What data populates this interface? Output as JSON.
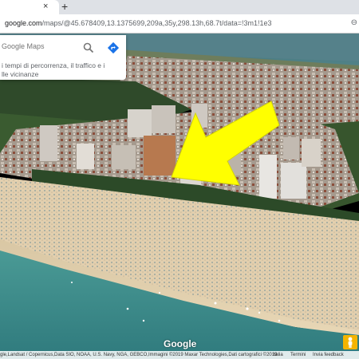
{
  "browser": {
    "url_host": "google.com",
    "url_path": "/maps/@45.678409,13.1375699,209a,35y,298.13h,68.7t/data=!3m1!1e3",
    "new_tab_symbol": "+",
    "close_symbol": "×"
  },
  "search": {
    "placeholder": "Google Maps",
    "hint": "i tempi di percorrenza, il traffico e i\nlle vicinanze"
  },
  "map": {
    "logo": "Google",
    "attribution": "gle,Landsat / Copernicus,Data SIO, NOAA, U.S. Navy, NGA, GEBCO,Immagini ©2019 Maxar Technologies,Dati cartografici ©2019",
    "links": {
      "italia": "Italia",
      "termini": "Termini",
      "feedback": "Invia feedback"
    }
  },
  "colors": {
    "arrow": "#ffff00",
    "sea": "#3f8a8a",
    "sand": "#e6d3b3",
    "pegman": "#f4b400"
  }
}
